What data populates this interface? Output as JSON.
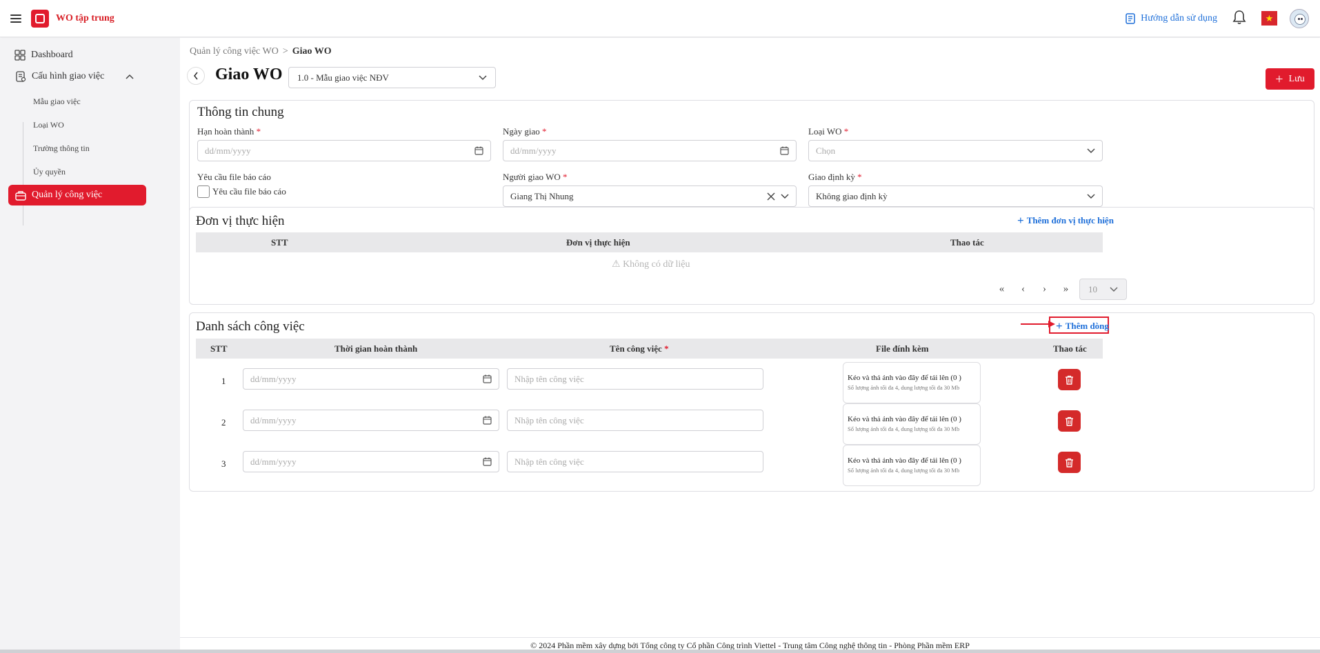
{
  "app": {
    "title": "WO tập trung"
  },
  "header": {
    "guide_label": "Hướng dẫn sử dụng"
  },
  "sidebar": {
    "items": [
      {
        "label": "Dashboard"
      },
      {
        "label": "Cấu hình giao việc"
      }
    ],
    "subitems": [
      {
        "label": "Mẫu giao việc"
      },
      {
        "label": "Loại WO"
      },
      {
        "label": "Trường thông tin"
      },
      {
        "label": "Ủy quyền"
      }
    ],
    "active": {
      "label": "Quản lý công việc"
    }
  },
  "breadcrumb": {
    "parent": "Quản lý công việc WO",
    "sep": ">",
    "current": "Giao WO"
  },
  "page": {
    "title": "Giao WO",
    "template_value": "1.0 - Mẫu giao việc NĐV",
    "save_label": "Lưu"
  },
  "general": {
    "title": "Thông tin chung",
    "deadline": {
      "label": "Hạn hoàn thành",
      "placeholder": "dd/mm/yyyy"
    },
    "assign_date": {
      "label": "Ngày giao",
      "placeholder": "dd/mm/yyyy"
    },
    "wo_type": {
      "label": "Loại WO",
      "placeholder": "Chọn"
    },
    "report_file": {
      "label": "Yêu cầu file báo cáo",
      "checkbox_label": "Yêu cầu file báo cáo"
    },
    "assigner": {
      "label": "Người giao WO",
      "value": "Giang Thị Nhung"
    },
    "periodic": {
      "label": "Giao định kỳ",
      "value": "Không giao định kỳ"
    },
    "required_mark": "*"
  },
  "units": {
    "title": "Đơn vị thực hiện",
    "add_label": "Thêm đơn vị thực hiện",
    "columns": [
      "STT",
      "Đơn vị thực hiện",
      "Thao tác"
    ],
    "empty": "Không có dữ liệu",
    "page_size": "10"
  },
  "tasks": {
    "title": "Danh sách công việc",
    "add_label": "Thêm dòng",
    "columns": [
      "STT",
      "Thời gian hoàn thành",
      "Tên công việc",
      "File đính kèm",
      "Thao tác"
    ],
    "required_mark": "*",
    "date_placeholder": "dd/mm/yyyy",
    "name_placeholder": "Nhập tên công việc",
    "upload_main": "Kéo và thả ảnh vào đây để tải lên (0 )",
    "upload_sub": "Số lượng ảnh tối đa 4, dung lượng tối đa 30 Mb",
    "rows": [
      {
        "stt": "1"
      },
      {
        "stt": "2"
      },
      {
        "stt": "3"
      }
    ]
  },
  "footer": {
    "text": "© 2024 Phần mềm xây dựng bởi Tổng công ty Cổ phần Công trình Viettel - Trung tâm Công nghệ thông tin - Phòng Phần mềm ERP"
  },
  "colors": {
    "brand": "#e11b2d",
    "link": "#1e6fd9"
  }
}
